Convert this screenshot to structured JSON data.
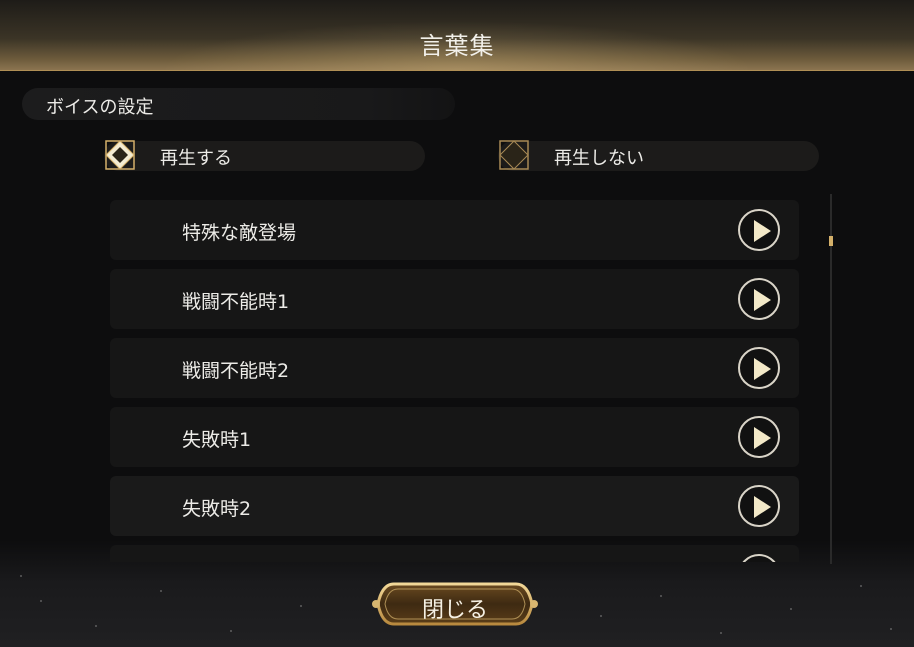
{
  "dialog": {
    "title": "言葉集",
    "section_label": "ボイスの設定",
    "options": {
      "play_label": "再生する",
      "noplay_label": "再生しない",
      "selected": "再生する"
    },
    "voice_list": [
      {
        "label": "特殊な敵登場"
      },
      {
        "label": "戦闘不能時1"
      },
      {
        "label": "戦闘不能時2"
      },
      {
        "label": "失敗時1"
      },
      {
        "label": "失敗時2"
      }
    ],
    "close_label": "閉じる"
  },
  "colors": {
    "accent_gold": "#d4b06a",
    "header_gold": "#8b7450",
    "row_bg": "#161616"
  },
  "icons": {
    "radio_selected": "diamond-radio-selected-icon",
    "radio_unselected": "diamond-radio-icon",
    "play": "play-icon"
  }
}
